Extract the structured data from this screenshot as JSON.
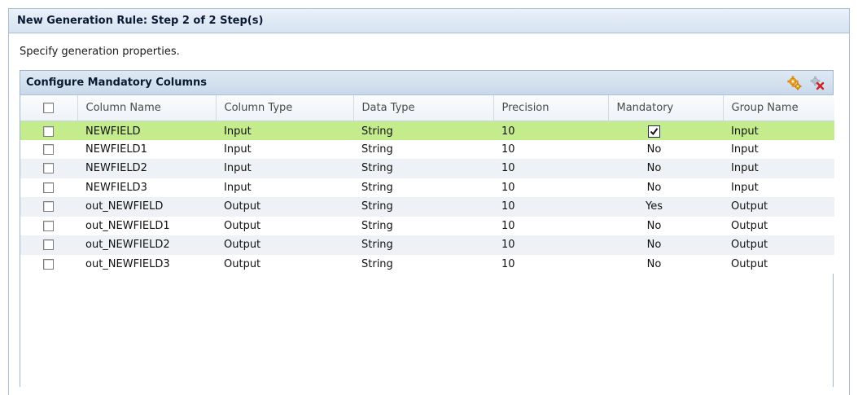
{
  "dialog": {
    "title": "New Generation Rule: Step 2 of 2 Step(s)",
    "instructions": "Specify generation properties."
  },
  "panel": {
    "title": "Configure Mandatory Columns",
    "icons": [
      "configure-gear-icon",
      "delete-icon"
    ]
  },
  "table": {
    "headers": {
      "column_name": "Column Name",
      "column_type": "Column Type",
      "data_type": "Data Type",
      "precision": "Precision",
      "mandatory": "Mandatory",
      "group_name": "Group Name"
    },
    "rows": [
      {
        "column_name": "NEWFIELD",
        "column_type": "Input",
        "data_type": "String",
        "precision": "10",
        "mandatory": "",
        "mandatory_checked": true,
        "group_name": "Input",
        "selected": true
      },
      {
        "column_name": "NEWFIELD1",
        "column_type": "Input",
        "data_type": "String",
        "precision": "10",
        "mandatory": "No",
        "group_name": "Input"
      },
      {
        "column_name": "NEWFIELD2",
        "column_type": "Input",
        "data_type": "String",
        "precision": "10",
        "mandatory": "No",
        "group_name": "Input"
      },
      {
        "column_name": "NEWFIELD3",
        "column_type": "Input",
        "data_type": "String",
        "precision": "10",
        "mandatory": "No",
        "group_name": "Input"
      },
      {
        "column_name": "out_NEWFIELD",
        "column_type": "Output",
        "data_type": "String",
        "precision": "10",
        "mandatory": "Yes",
        "group_name": "Output"
      },
      {
        "column_name": "out_NEWFIELD1",
        "column_type": "Output",
        "data_type": "String",
        "precision": "10",
        "mandatory": "No",
        "group_name": "Output"
      },
      {
        "column_name": "out_NEWFIELD2",
        "column_type": "Output",
        "data_type": "String",
        "precision": "10",
        "mandatory": "No",
        "group_name": "Output"
      },
      {
        "column_name": "out_NEWFIELD3",
        "column_type": "Output",
        "data_type": "String",
        "precision": "10",
        "mandatory": "No",
        "group_name": "Output"
      }
    ]
  },
  "colors": {
    "selected_row": "#c5ec8c",
    "alt_row": "#eef2f6",
    "header_bg": "#d6e3f1"
  }
}
